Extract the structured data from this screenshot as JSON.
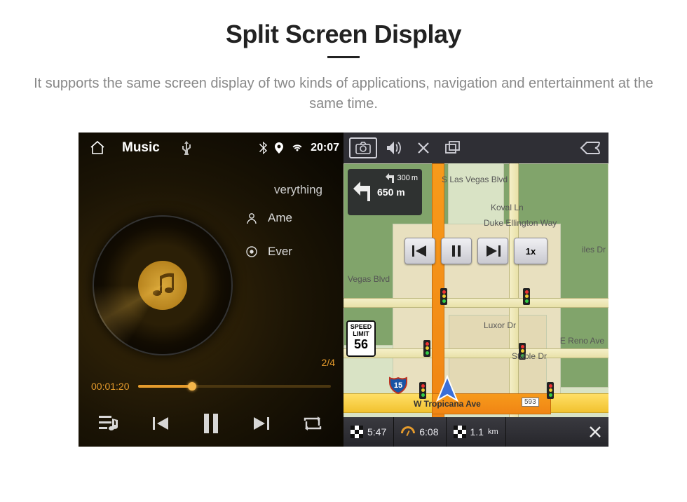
{
  "heading": "Split Screen Display",
  "subheading": "It supports the same screen display of two kinds of applications, navigation and entertainment at the same time.",
  "statusbar": {
    "time": "20:07"
  },
  "music": {
    "title": "Music",
    "now_playing_hint": "verything",
    "artist_line": "Ame",
    "track_line": "Ever",
    "track_counter": "2/4",
    "elapsed": "00:01:20"
  },
  "map": {
    "turn": {
      "primary_distance": "650",
      "primary_unit": "m",
      "secondary_distance": "300",
      "secondary_unit": "m"
    },
    "speed_limit": {
      "label_top": "SPEED",
      "label_mid": "LIMIT",
      "value": "56"
    },
    "sim_speed": "1x",
    "streets": {
      "s_las_vegas": "S Las Vegas Blvd",
      "koval": "Koval Ln",
      "duke": "Duke Ellington Way",
      "luxor": "Luxor Dr",
      "reno": "E Reno Ave",
      "stable": "Stable Dr",
      "tropicana": "W Tropicana Ave",
      "tropicana_num": "593",
      "vegas_side": "Vegas Blvd",
      "iles": "iles Dr"
    },
    "bottombar": {
      "eta": "5:47",
      "arrival": "6:08",
      "distance": "1.1",
      "distance_unit": "km"
    }
  }
}
